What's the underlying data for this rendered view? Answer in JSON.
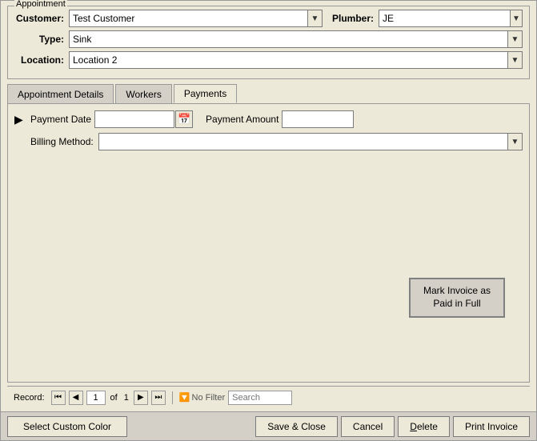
{
  "dialog": {
    "title": "Appointment"
  },
  "appointment": {
    "group_label": "Appointment",
    "customer_label": "Customer:",
    "customer_value": "Test Customer",
    "plumber_label": "Plumber:",
    "plumber_value": "JE",
    "type_label": "Type:",
    "type_value": "Sink",
    "location_label": "Location:",
    "location_value": "Location 2"
  },
  "tabs": {
    "appointment_details": "Appointment Details",
    "workers": "Workers",
    "payments": "Payments"
  },
  "payments": {
    "payment_date_label": "Payment Date",
    "payment_amount_label": "Payment Amount",
    "billing_method_label": "Billing Method:",
    "payment_date_value": "",
    "payment_amount_value": "",
    "billing_method_value": "",
    "mark_paid_btn": "Mark Invoice as Paid in Full"
  },
  "record_nav": {
    "label": "Record:",
    "first_icon": "⏮",
    "prev_icon": "◀",
    "current": "1",
    "of_label": "of",
    "total": "1",
    "next_icon": "▶",
    "last_icon": "⏭",
    "no_filter": "No Filter",
    "search_placeholder": "Search"
  },
  "footer": {
    "select_custom_color": "Select Custom Color",
    "save_close": "Save & Close",
    "cancel": "Cancel",
    "delete": "Delete",
    "print_invoice": "Print Invoice"
  }
}
